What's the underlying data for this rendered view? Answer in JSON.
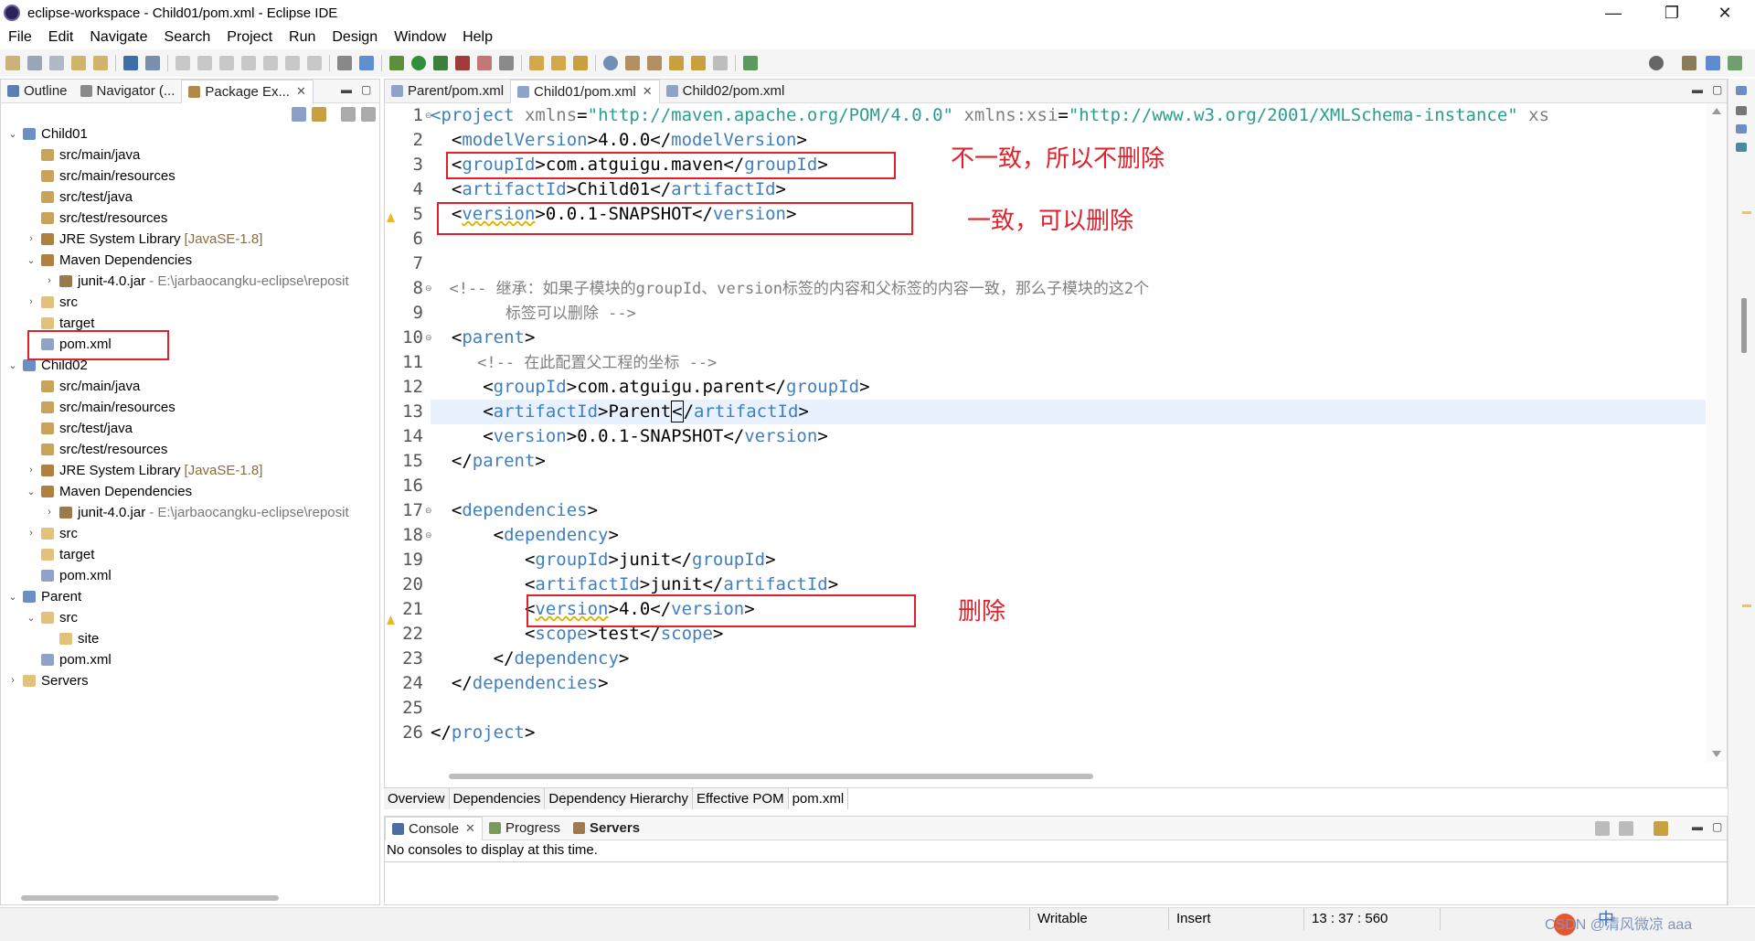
{
  "window": {
    "title": "eclipse-workspace - Child01/pom.xml - Eclipse IDE",
    "controls": {
      "minimize": "—",
      "restore": "❐",
      "close": "✕"
    }
  },
  "menu": [
    "File",
    "Edit",
    "Navigate",
    "Search",
    "Project",
    "Run",
    "Design",
    "Window",
    "Help"
  ],
  "left_panel": {
    "tabs": [
      {
        "label": "Outline",
        "icon": "outline-icon"
      },
      {
        "label": "Navigator (...",
        "icon": "navigator-icon"
      },
      {
        "label": "Package Ex...",
        "icon": "package-explorer-icon",
        "close": "✕"
      }
    ],
    "tree": [
      {
        "label": "Child01",
        "icon": "project-icon",
        "twisty": "v"
      },
      {
        "label": "src/main/java",
        "icon": "source-folder-icon"
      },
      {
        "label": "src/main/resources",
        "icon": "source-folder-icon"
      },
      {
        "label": "src/test/java",
        "icon": "source-folder-icon"
      },
      {
        "label": "src/test/resources",
        "icon": "source-folder-icon"
      },
      {
        "label": "JRE System Library",
        "extra": "[JavaSE-1.8]",
        "icon": "library-icon",
        "twisty": ">"
      },
      {
        "label": "Maven Dependencies",
        "icon": "library-icon",
        "twisty": "v"
      },
      {
        "label": "junit-4.0.jar",
        "extra": "- E:\\jarbaocangku-eclipse\\reposit",
        "icon": "jar-icon",
        "twisty": ">"
      },
      {
        "label": "src",
        "icon": "folder-icon",
        "twisty": ">"
      },
      {
        "label": "target",
        "icon": "folder-icon"
      },
      {
        "label": "pom.xml",
        "icon": "xml-file-icon"
      },
      {
        "label": "Child02",
        "icon": "project-icon",
        "twisty": "v"
      },
      {
        "label": "src/main/java",
        "icon": "source-folder-icon"
      },
      {
        "label": "src/main/resources",
        "icon": "source-folder-icon"
      },
      {
        "label": "src/test/java",
        "icon": "source-folder-icon"
      },
      {
        "label": "src/test/resources",
        "icon": "source-folder-icon"
      },
      {
        "label": "JRE System Library",
        "extra": "[JavaSE-1.8]",
        "icon": "library-icon",
        "twisty": ">"
      },
      {
        "label": "Maven Dependencies",
        "icon": "library-icon",
        "twisty": "v"
      },
      {
        "label": "junit-4.0.jar",
        "extra": "- E:\\jarbaocangku-eclipse\\reposit",
        "icon": "jar-icon",
        "twisty": ">"
      },
      {
        "label": "src",
        "icon": "folder-icon",
        "twisty": ">"
      },
      {
        "label": "target",
        "icon": "folder-icon"
      },
      {
        "label": "pom.xml",
        "icon": "xml-file-icon"
      },
      {
        "label": "Parent",
        "icon": "project-icon",
        "twisty": "v"
      },
      {
        "label": "src",
        "icon": "folder-icon",
        "twisty": "v"
      },
      {
        "label": "site",
        "icon": "folder-icon"
      },
      {
        "label": "pom.xml",
        "icon": "xml-file-icon"
      },
      {
        "label": "Servers",
        "icon": "folder-icon",
        "twisty": ">"
      }
    ]
  },
  "editor": {
    "tabs": [
      {
        "label": "Parent/pom.xml"
      },
      {
        "label": "Child01/pom.xml",
        "close": "✕"
      },
      {
        "label": "Child02/pom.xml"
      }
    ],
    "line_numbers": [
      "1",
      "2",
      "3",
      "4",
      "5",
      "6",
      "7",
      "8",
      "9",
      "10",
      "11",
      "12",
      "13",
      "14",
      "15",
      "16",
      "17",
      "18",
      "19",
      "20",
      "21",
      "22",
      "23",
      "24",
      "25",
      "26"
    ],
    "code": {
      "l1": {
        "open": "<",
        "tag": "project",
        "a1": " xmlns",
        "eq1": "=",
        "v1": "\"http://maven.apache.org/POM/4.0.0\"",
        "a2": " xmlns:xsi",
        "eq2": "=",
        "v2": "\"http://www.w3.org/2001/XMLSchema-instance\"",
        "a3": " xs"
      },
      "l2": {
        "indent": "  ",
        "tag": "modelVersion",
        "text": "4.0.0"
      },
      "l3": {
        "indent": "  ",
        "tag": "groupId",
        "text": "com.atguigu.maven"
      },
      "l4": {
        "indent": "  ",
        "tag": "artifactId",
        "text": "Child01"
      },
      "l5": {
        "indent": "  ",
        "tag": "version",
        "text": "0.0.1-SNAPSHOT"
      },
      "l8": "  <!-- 继承：如果子模块的groupId、version标签的内容和父标签的内容一致，那么子模块的这2个",
      "l9": "        标签可以删除 -->",
      "l10": {
        "indent": "  ",
        "tag": "parent"
      },
      "l11": "     <!-- 在此配置父工程的坐标 -->",
      "l12": {
        "indent": "     ",
        "tag": "groupId",
        "text": "com.atguigu.parent"
      },
      "l13": {
        "indent": "     ",
        "tag": "artifactId",
        "text_before": "Parent",
        "text_cursor": "<",
        "close_rest": "/",
        "close_tag": "artifactId"
      },
      "l14": {
        "indent": "     ",
        "tag": "version",
        "text": "0.0.1-SNAPSHOT"
      },
      "l15": {
        "indent": "  ",
        "tag": "parent"
      },
      "l17": {
        "indent": "  ",
        "tag": "dependencies"
      },
      "l18": {
        "indent": "      ",
        "tag": "dependency"
      },
      "l19": {
        "indent": "         ",
        "tag": "groupId",
        "text": "junit"
      },
      "l20": {
        "indent": "         ",
        "tag": "artifactId",
        "text": "junit"
      },
      "l21": {
        "indent": "         ",
        "tag": "version",
        "text": "4.0"
      },
      "l22": {
        "indent": "         ",
        "tag": "scope",
        "text": "test"
      },
      "l23": {
        "indent": "      ",
        "tag": "dependency"
      },
      "l24": {
        "indent": "  ",
        "tag": "dependencies"
      },
      "l26": {
        "indent": "",
        "tag": "project"
      }
    },
    "annotations": {
      "groupid_note": "不一致，所以不删除",
      "version_note": "一致，可以删除",
      "dep_version_note": "删除"
    },
    "pom_tabs": [
      "Overview",
      "Dependencies",
      "Dependency Hierarchy",
      "Effective POM",
      "pom.xml"
    ]
  },
  "console": {
    "tabs": [
      {
        "label": "Console",
        "close": "✕"
      },
      {
        "label": "Progress"
      },
      {
        "label": "Servers"
      }
    ],
    "message": "No consoles to display at this time."
  },
  "status": {
    "mode": "Writable",
    "insert": "Insert",
    "position": "13 : 37 : 560",
    "ime": "中",
    "watermark": "CSDN @清风微凉 aaa"
  },
  "colors": {
    "tag": "#3f7fbf",
    "attribute": "#7f7f7f",
    "value": "#2a9d8f",
    "annotation_red": "#e0202a",
    "current_line": "#e8f2fe"
  }
}
